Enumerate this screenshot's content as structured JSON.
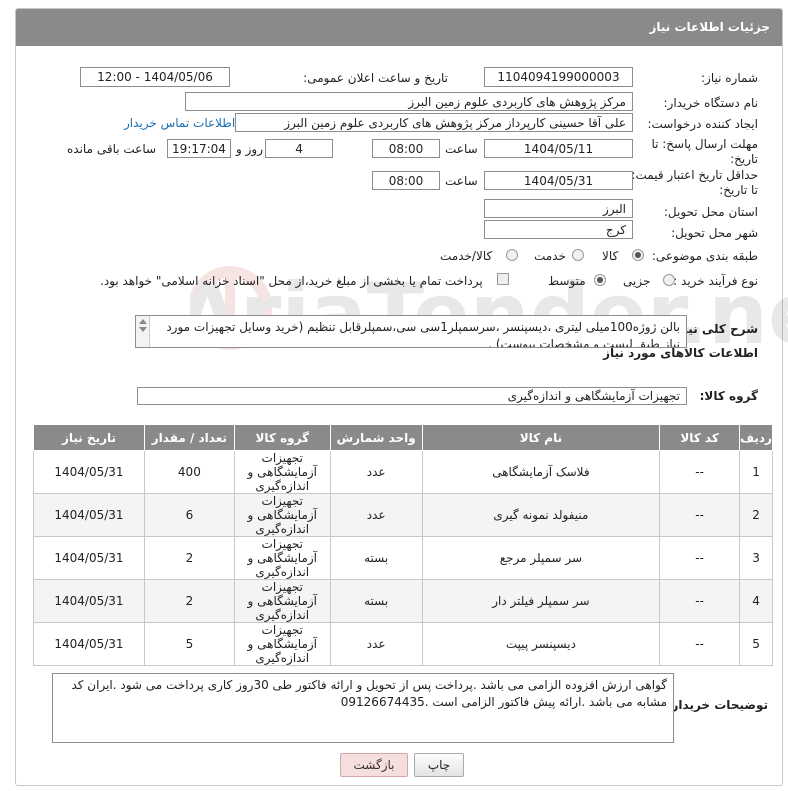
{
  "header": {
    "title": "جزئیات اطلاعات نیاز"
  },
  "fields": {
    "need_number_label": "شماره نیاز:",
    "need_number": "1104094199000003",
    "announce_label": "تاریخ و ساعت اعلان عمومی:",
    "announce_value": "1404/05/06 - 12:00",
    "buyer_org_label": "نام دستگاه خریدار:",
    "buyer_org": "مرکز پژوهش های کاربردی علوم زمین البرز",
    "creator_label": "ایجاد کننده درخواست:",
    "creator": "علی آقا حسینی کارپرداز مرکز پژوهش های کاربردی علوم زمین البرز",
    "contact_link": "اطلاعات تماس خریدار",
    "deadline_label_1": "مهلت ارسال پاسخ: تا",
    "deadline_label_2": "تاریخ:",
    "deadline_date": "1404/05/11",
    "time_label": "ساعت",
    "deadline_time": "08:00",
    "days_value": "4",
    "days_label": "روز و",
    "remaining_time": "19:17:04",
    "remaining_label": "ساعت باقی مانده",
    "validity_label_1": "حداقل تاریخ اعتبار قیمت:",
    "validity_label_2": "تا تاریخ:",
    "validity_date": "1404/05/31",
    "validity_time": "08:00",
    "province_label": "استان محل تحویل:",
    "province": "البرز",
    "city_label": "شهر محل تحویل:",
    "city": "کرج",
    "category_label": "طبقه بندی موضوعی:",
    "category_options": [
      "کالا",
      "خدمت",
      "کالا/خدمت"
    ],
    "process_label": "نوع فرآیند خرید :",
    "process_options": [
      "جزیی",
      "متوسط"
    ],
    "payment_note": "پرداخت تمام یا بخشی از مبلغ خرید،از محل \"اسناد خزانه اسلامی\" خواهد بود.",
    "description_label": "شرح کلی نیاز:",
    "description": "بالن ژوژه100میلی لیتری ،دیسپنسر ،سرسمپلر1سی سی،سمپلرقابل تنظیم (خرید وسایل تجهیزات مورد نیاز طبق لیست و مشخصات پیوست) ."
  },
  "goods_section": {
    "title": "اطلاعات کالاهای مورد نیاز",
    "group_label": "گروه کالا:",
    "group_value": "تجهیزات آزمایشگاهی و اندازه‌گیری"
  },
  "table": {
    "headers": [
      "ردیف",
      "کد کالا",
      "نام کالا",
      "واحد شمارش",
      "گروه کالا",
      "تعداد / مقدار",
      "تاریخ نیاز"
    ],
    "rows": [
      {
        "row": "1",
        "code": "--",
        "name": "فلاسک آزمایشگاهی",
        "unit": "عدد",
        "group": [
          "تجهیزات",
          "آزمایشگاهی و",
          "اندازه‌گیری"
        ],
        "qty": "400",
        "date": "1404/05/31"
      },
      {
        "row": "2",
        "code": "--",
        "name": "منیفولد نمونه گیری",
        "unit": "عدد",
        "group": [
          "تجهیزات",
          "آزمایشگاهی و",
          "اندازه‌گیری"
        ],
        "qty": "6",
        "date": "1404/05/31"
      },
      {
        "row": "3",
        "code": "--",
        "name": "سر سمپلر مرجع",
        "unit": "بسته",
        "group": [
          "تجهیزات",
          "آزمایشگاهی و",
          "اندازه‌گیری"
        ],
        "qty": "2",
        "date": "1404/05/31"
      },
      {
        "row": "4",
        "code": "--",
        "name": "سر سمپلر فیلتر دار",
        "unit": "بسته",
        "group": [
          "تجهیزات",
          "آزمایشگاهی و",
          "اندازه‌گیری"
        ],
        "qty": "2",
        "date": "1404/05/31"
      },
      {
        "row": "5",
        "code": "--",
        "name": "دیسپنسر پیپت",
        "unit": "عدد",
        "group": [
          "تجهیزات",
          "آزمایشگاهی و",
          "اندازه‌گیری"
        ],
        "qty": "5",
        "date": "1404/05/31"
      }
    ]
  },
  "buyer_notes": {
    "label": "توضیحات خریدار:",
    "text": "گواهی ارزش افزوده الزامی می باشد .پرداخت پس از تحویل  و ارائه فاکتور طی 30روز کاری پرداخت می شود .ایران کد مشابه می باشد .ارائه پیش فاکتور الزامی است .09126674435"
  },
  "buttons": {
    "print": "چاپ",
    "back": "بازگشت"
  },
  "watermark_text": "AriaTender.net",
  "colors": {
    "header_bg": "#8a8a8a",
    "link": "#1c6fb5",
    "back_button": "#f7dede"
  }
}
